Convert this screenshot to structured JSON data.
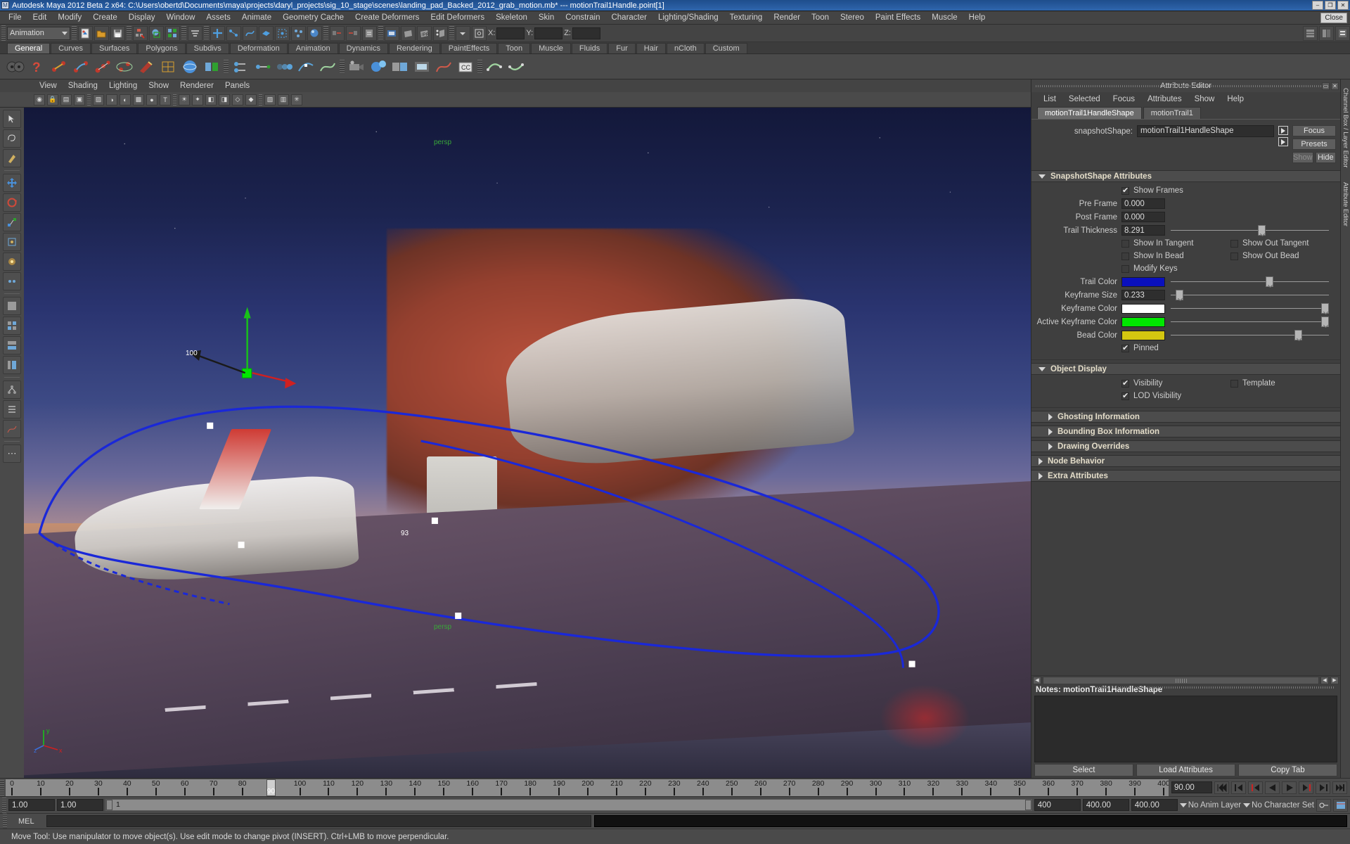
{
  "titlebar": {
    "text": "Autodesk Maya 2012 Beta 2 x64: C:\\Users\\obertd\\Documents\\maya\\projects\\daryl_projects\\sig_10_stage\\scenes\\landing_pad_Backed_2012_grab_motion.mb*   ---  motionTrail1Handle.point[1]",
    "icon": "maya-icon",
    "minimize": "–",
    "maximize": "❐",
    "close": "✕"
  },
  "menubar": {
    "items": [
      "File",
      "Edit",
      "Modify",
      "Create",
      "Display",
      "Window",
      "Assets",
      "Animate",
      "Geometry Cache",
      "Create Deformers",
      "Edit Deformers",
      "Skeleton",
      "Skin",
      "Constrain",
      "Character",
      "Lighting/Shading",
      "Texturing",
      "Render",
      "Toon",
      "Stereo",
      "Paint Effects",
      "Muscle",
      "Help"
    ],
    "close_label": "Close"
  },
  "statusline": {
    "menuset": "Animation",
    "axis": {
      "x_label": "X:",
      "y_label": "Y:",
      "z_label": "Z:",
      "x_value": "",
      "y_value": "",
      "z_value": ""
    }
  },
  "shelf": {
    "tabs": [
      "General",
      "Curves",
      "Surfaces",
      "Polygons",
      "Subdivs",
      "Deformation",
      "Animation",
      "Dynamics",
      "Rendering",
      "PaintEffects",
      "Toon",
      "Muscle",
      "Fluids",
      "Fur",
      "Hair",
      "nCloth",
      "Custom"
    ],
    "active_tab": "General"
  },
  "viewport": {
    "panel_menu": [
      "View",
      "Shading",
      "Lighting",
      "Show",
      "Renderer",
      "Panels"
    ],
    "persp_label": "persp",
    "top_label": "persp",
    "axis_x": "x",
    "axis_y": "y",
    "axis_z": "z",
    "keyframe_labels": [
      "100",
      "93"
    ]
  },
  "attribute_editor": {
    "title": "Attribute Editor",
    "menu": [
      "List",
      "Selected",
      "Focus",
      "Attributes",
      "Show",
      "Help"
    ],
    "tabs": [
      "motionTrail1HandleShape",
      "motionTrail1"
    ],
    "active_tab": "motionTrail1HandleShape",
    "node_label": "snapshotShape:",
    "node_name": "motionTrail1HandleShape",
    "side_buttons": {
      "focus": "Focus",
      "presets": "Presets",
      "show": "Show",
      "hide": "Hide"
    },
    "sections": {
      "snapshot": {
        "title": "SnapshotShape Attributes",
        "expanded": true,
        "checkboxes_top": [
          {
            "label": "Show Frames",
            "checked": true
          }
        ],
        "fields": [
          {
            "label": "Pre Frame",
            "value": "0.000",
            "slider": false
          },
          {
            "label": "Post Frame",
            "value": "0.000",
            "slider": false
          },
          {
            "label": "Trail Thickness",
            "value": "8.291",
            "slider": true,
            "knob_pct": 55
          }
        ],
        "checkbox_grid": [
          {
            "left": {
              "label": "Show In Tangent",
              "checked": false
            },
            "right": {
              "label": "Show Out Tangent",
              "checked": false
            }
          },
          {
            "left": {
              "label": "Show In Bead",
              "checked": false
            },
            "right": {
              "label": "Show Out Bead",
              "checked": false
            }
          },
          {
            "left": {
              "label": "Modify Keys",
              "checked": false
            },
            "right": null
          }
        ],
        "colors": [
          {
            "label": "Trail Color",
            "hex": "#0a10bd",
            "knob_pct": 60
          },
          {
            "label": "Keyframe Size",
            "value": "0.233",
            "is_value": true,
            "knob_pct": 4
          },
          {
            "label": "Keyframe Color",
            "hex": "#ffffff",
            "knob_pct": 96
          },
          {
            "label": "Active Keyframe Color",
            "hex": "#00e800",
            "knob_pct": 96
          },
          {
            "label": "Bead Color",
            "hex": "#d4c710",
            "knob_pct": 80
          }
        ],
        "pinned": {
          "label": "Pinned",
          "checked": true
        }
      },
      "object_display": {
        "title": "Object Display",
        "expanded": true,
        "rows": [
          {
            "left": {
              "label": "Visibility",
              "checked": true
            },
            "right": {
              "label": "Template",
              "checked": false
            }
          },
          {
            "left": {
              "label": "LOD Visibility",
              "checked": true
            },
            "right": null
          }
        ]
      },
      "collapsed": [
        {
          "title": "Ghosting Information",
          "indent": true
        },
        {
          "title": "Bounding Box Information",
          "indent": true
        },
        {
          "title": "Drawing Overrides",
          "indent": true
        },
        {
          "title": "Node Behavior",
          "indent": false
        },
        {
          "title": "Extra Attributes",
          "indent": false
        }
      ]
    },
    "notes_label": "Notes: motionTrail1HandleShape",
    "footer_buttons": [
      "Select",
      "Load Attributes",
      "Copy Tab"
    ]
  },
  "right_strip": {
    "labels": [
      "Channel Box / Layer Editor",
      "Attribute Editor"
    ]
  },
  "timeslider": {
    "ticks": [
      0,
      10,
      20,
      30,
      40,
      50,
      60,
      70,
      80,
      90,
      100,
      110,
      120,
      130,
      140,
      150,
      160,
      170,
      180,
      190,
      200,
      210,
      220,
      230,
      240,
      250,
      260,
      270,
      280,
      290,
      300,
      310,
      320,
      330,
      340,
      350,
      360,
      370,
      380,
      390,
      400
    ],
    "current_frame": "90",
    "current_field": "90.00",
    "transport": [
      "go-to-start-icon",
      "step-back-key-icon",
      "step-back-frame-icon",
      "play-backwards-icon",
      "play-forwards-icon",
      "step-forward-frame-icon",
      "step-forward-key-icon",
      "go-to-end-icon"
    ]
  },
  "rangeslider": {
    "anim_start": "1.00",
    "range_start": "1.00",
    "bar_label": "1",
    "range_end": "400",
    "anim_end": "400.00",
    "playback_end": "400.00",
    "anim_layer": "No Anim Layer",
    "character_set": "No Character Set"
  },
  "commandline": {
    "mel_label": "MEL",
    "input_value": "",
    "output_value": ""
  },
  "helpline": {
    "text": "Move Tool: Use manipulator to move object(s). Use edit mode to change pivot (INSERT).  Ctrl+LMB to move perpendicular."
  },
  "colors": {
    "trail_blue": "#1a28d8",
    "keyframe_white": "#ffffff",
    "active_green": "#00e800",
    "bead_yellow": "#d4c710",
    "title_blue": "#2f66ad"
  }
}
